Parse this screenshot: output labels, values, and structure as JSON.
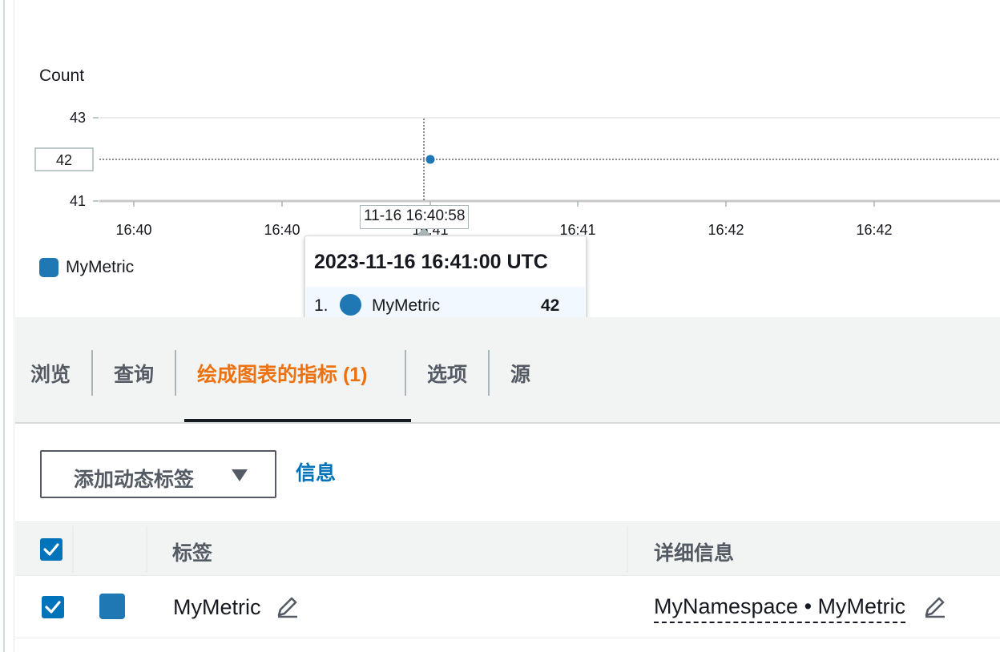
{
  "chart_data": {
    "type": "line",
    "unit_label": "Count",
    "y_ticks": [
      "43",
      "41"
    ],
    "y_hover_label": "42",
    "ylim": [
      41,
      43
    ],
    "x_tick_labels": [
      "16:40",
      "16:40",
      "16:41",
      "16:41",
      "16:42",
      "16:42"
    ],
    "hover_time_label": "11-16 16:40:58",
    "series": [
      {
        "name": "MyMetric",
        "color": "#1f77b4",
        "points": [
          {
            "time": "2023-11-16 16:41:00 UTC",
            "value": 42
          }
        ]
      }
    ],
    "legend_position": "bottom-left",
    "grid": true
  },
  "legend": {
    "label": "MyMetric",
    "color": "#1f77b4"
  },
  "tooltip": {
    "title": "2023-11-16 16:41:00 UTC",
    "rows": [
      {
        "index": "1.",
        "name": "MyMetric",
        "value": "42",
        "color": "#1f77b4"
      }
    ]
  },
  "tabs": [
    {
      "label": "浏览",
      "active": false
    },
    {
      "label": "查询",
      "active": false
    },
    {
      "label": "绘成图表的指标 (1)",
      "active": true
    },
    {
      "label": "选项",
      "active": false
    },
    {
      "label": "源",
      "active": false
    }
  ],
  "toolbar": {
    "dynamic_label_button": "添加动态标签",
    "info_link": "信息"
  },
  "table": {
    "headers": {
      "label": "标签",
      "details": "详细信息"
    },
    "rows": [
      {
        "checked": true,
        "color": "#1f77b4",
        "label": "MyMetric",
        "details": "MyNamespace • MyMetric"
      }
    ]
  },
  "colors": {
    "accent": "#ec7211",
    "link": "#0073bb",
    "series": "#1f77b4"
  },
  "icons": {
    "edit": "pencil-icon",
    "dropdown": "caret-down-icon",
    "check": "check-icon"
  }
}
